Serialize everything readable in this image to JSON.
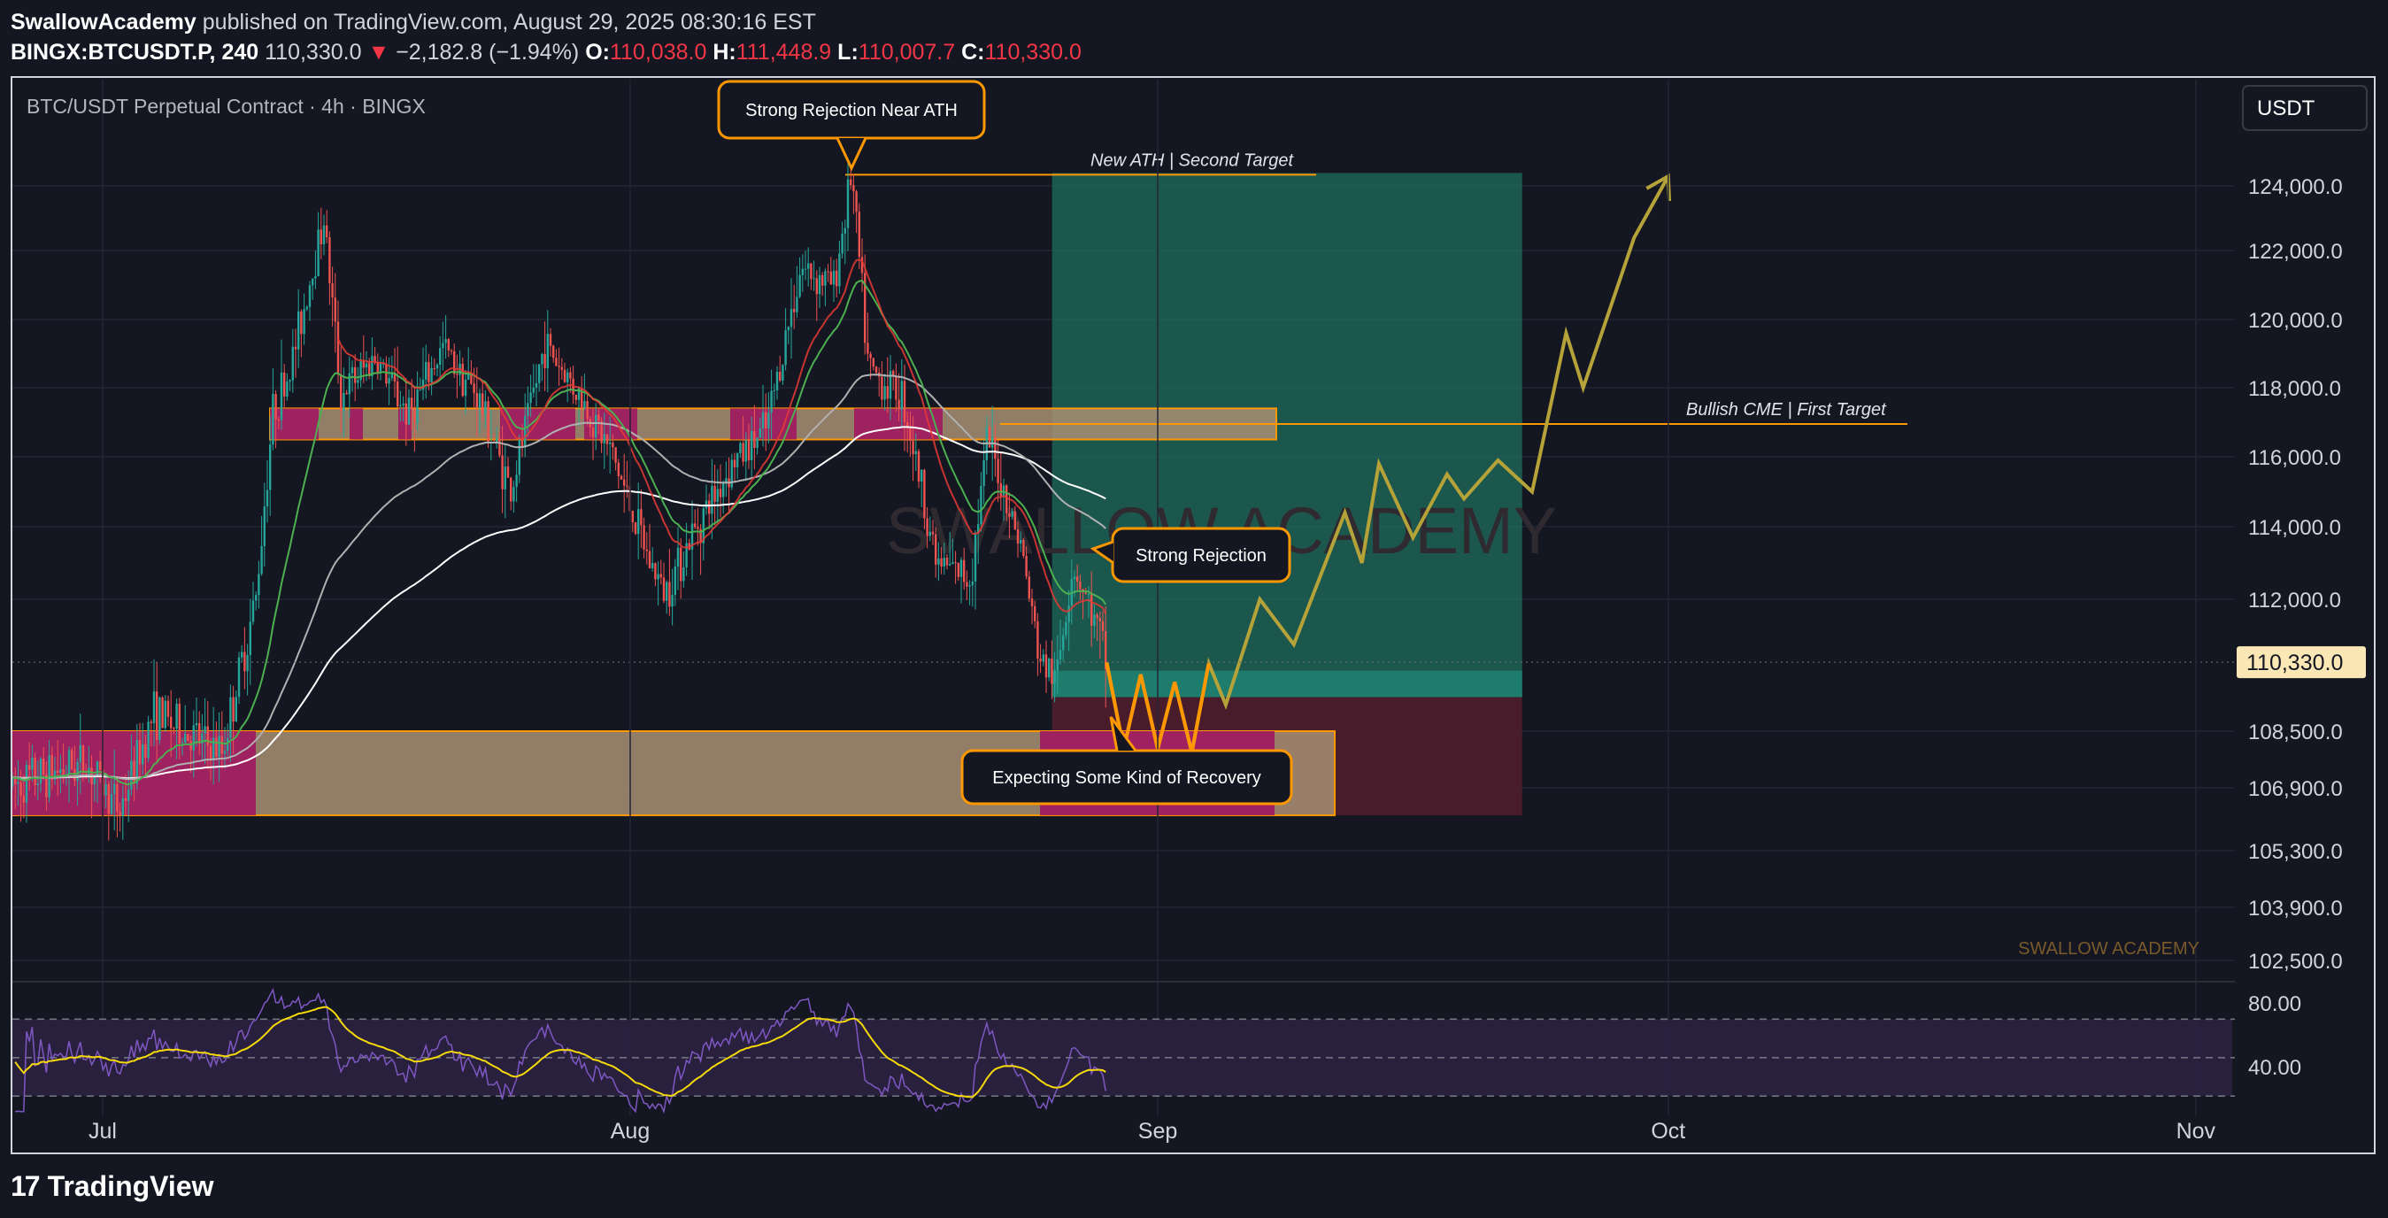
{
  "header": {
    "author": "SwallowAcademy",
    "published": "published on TradingView.com, August 29, 2025 08:30:16 EST",
    "symbol": "BINGX:BTCUSDT.P, 240",
    "last": "110,330.0",
    "change_arrow": "▼",
    "change": "−2,182.8 (−1.94%)",
    "o_label": "O:",
    "o_value": "110,038.0",
    "h_label": "H:",
    "h_value": "111,448.9",
    "l_label": "L:",
    "l_value": "110,007.7",
    "c_label": "C:",
    "c_value": "110,330.0"
  },
  "footer": {
    "logo_glyph": "17",
    "brand": "TradingView"
  },
  "colors": {
    "background": "#141722",
    "grid": "#232633",
    "candle_up": "#26a69a",
    "candle_down": "#ef5350",
    "target_zone": "#1f6e5e",
    "stop_zone": "#5a1f2e",
    "support_zone": "#a88f73",
    "support_highlight": "#a0175f",
    "callout_border": "#ff9800",
    "projection": "#b5a33a",
    "rsi_line": "#7e57c2",
    "rsi_ma": "#f5d90a",
    "ema_fast": "#4caf50",
    "ema_red": "#e53935",
    "ema_grey": "#b0b0b0",
    "ema_white": "#ffffff",
    "price_tag": "#fbe7b6"
  },
  "chart_data": {
    "type": "candlestick",
    "title": "BTC/USDT Perpetual Contract · 4h · BINGX",
    "currency": "USDT",
    "watermark_center": "SWALLOW ACADEMY",
    "watermark_corner": "SWALLOW ACADEMY",
    "y_ticks": [
      "124,000.0",
      "122,000.0",
      "120,000.0",
      "118,000.0",
      "116,000.0",
      "114,000.0",
      "112,000.0",
      "108,500.0",
      "106,900.0",
      "105,300.0",
      "103,900.0",
      "102,500.0"
    ],
    "x_ticks": [
      "Jul",
      "Aug",
      "Sep",
      "Oct",
      "Nov"
    ],
    "last_price_label": "110,330.0",
    "last_price": 110330,
    "rsi": {
      "ticks": [
        "80.00",
        "40.00"
      ],
      "upper": 70,
      "middle": 50,
      "lower": 30
    },
    "zones": {
      "resistance": {
        "low": 116500,
        "high": 117400
      },
      "support": {
        "low": 106200,
        "high": 108500
      },
      "target_box": {
        "low": 109400,
        "high": 124400
      },
      "stop_box": {
        "low": 106200,
        "high": 109400
      }
    },
    "levels": [
      {
        "label": "New ATH | Second Target",
        "price": 124400
      },
      {
        "label": "Bullish CME | First Target",
        "price": 117000
      }
    ],
    "annotations": [
      {
        "text": "Strong Rejection Near ATH"
      },
      {
        "text": "Strong Rejection"
      },
      {
        "text": "Expecting Some Kind of Recovery"
      }
    ],
    "price_path": [
      [
        "2025-06-23",
        104500
      ],
      [
        "2025-06-25",
        106800
      ],
      [
        "2025-06-27",
        107200
      ],
      [
        "2025-06-30",
        107600
      ],
      [
        "2025-07-02",
        106300
      ],
      [
        "2025-07-04",
        109000
      ],
      [
        "2025-07-06",
        108400
      ],
      [
        "2025-07-08",
        107900
      ],
      [
        "2025-07-10",
        112000
      ],
      [
        "2025-07-11",
        117300
      ],
      [
        "2025-07-12",
        118500
      ],
      [
        "2025-07-14",
        123000
      ],
      [
        "2025-07-15",
        117800
      ],
      [
        "2025-07-17",
        118900
      ],
      [
        "2025-07-19",
        117200
      ],
      [
        "2025-07-21",
        119200
      ],
      [
        "2025-07-23",
        117800
      ],
      [
        "2025-07-25",
        115000
      ],
      [
        "2025-07-27",
        119300
      ],
      [
        "2025-07-29",
        117800
      ],
      [
        "2025-07-31",
        116000
      ],
      [
        "2025-08-02",
        113200
      ],
      [
        "2025-08-03",
        112200
      ],
      [
        "2025-08-05",
        114100
      ],
      [
        "2025-08-07",
        115800
      ],
      [
        "2025-08-09",
        116800
      ],
      [
        "2025-08-11",
        121500
      ],
      [
        "2025-08-13",
        121000
      ],
      [
        "2025-08-14",
        124400
      ],
      [
        "2025-08-15",
        118500
      ],
      [
        "2025-08-17",
        117800
      ],
      [
        "2025-08-19",
        113000
      ],
      [
        "2025-08-21",
        112600
      ],
      [
        "2025-08-22",
        116500
      ],
      [
        "2025-08-24",
        113400
      ],
      [
        "2025-08-25",
        110500
      ],
      [
        "2025-08-26",
        109800
      ],
      [
        "2025-08-27",
        113000
      ],
      [
        "2025-08-28",
        111800
      ],
      [
        "2025-08-29",
        110330
      ]
    ],
    "projection_path": [
      [
        "2025-08-29",
        110330
      ],
      [
        "2025-08-30",
        108000
      ],
      [
        "2025-08-31",
        110000
      ],
      [
        "2025-09-01",
        108000
      ],
      [
        "2025-09-02",
        109800
      ],
      [
        "2025-09-03",
        107900
      ],
      [
        "2025-09-04",
        110300
      ],
      [
        "2025-09-05",
        109200
      ],
      [
        "2025-09-07",
        112000
      ],
      [
        "2025-09-09",
        110800
      ],
      [
        "2025-09-12",
        114400
      ],
      [
        "2025-09-13",
        113000
      ],
      [
        "2025-09-14",
        115800
      ],
      [
        "2025-09-16",
        113700
      ],
      [
        "2025-09-18",
        115500
      ],
      [
        "2025-09-19",
        114800
      ],
      [
        "2025-09-21",
        115900
      ],
      [
        "2025-09-23",
        115000
      ],
      [
        "2025-09-25",
        119600
      ],
      [
        "2025-09-26",
        118000
      ],
      [
        "2025-09-29",
        122400
      ],
      [
        "2025-10-01",
        124300
      ]
    ]
  }
}
